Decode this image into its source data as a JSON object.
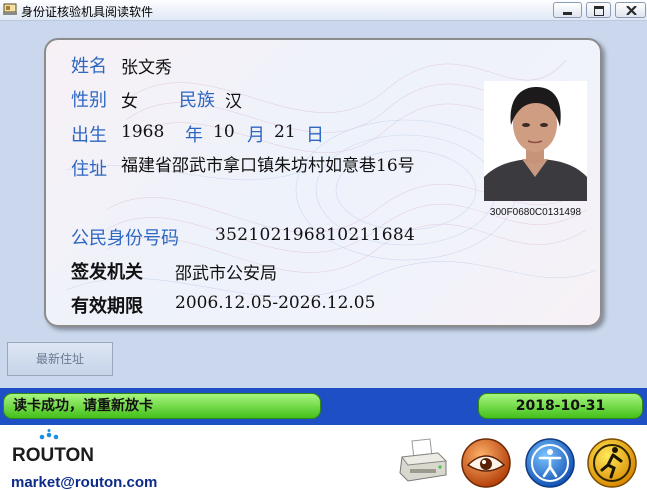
{
  "window": {
    "title": "身份证核验机具阅读软件"
  },
  "card": {
    "name_label": "姓名",
    "name": "张文秀",
    "gender_label": "性别",
    "gender": "女",
    "ethnicity_label": "民族",
    "ethnicity": "汉",
    "birth_label": "出生",
    "birth_year": "1968",
    "year_unit": "年",
    "birth_month": "10",
    "month_unit": "月",
    "birth_day": "21",
    "day_unit": "日",
    "address_label": "住址",
    "address": "福建省邵武市拿口镇朱坊村如意巷16号",
    "id_number_label": "公民身份号码",
    "id_number": "352102196810211684",
    "authority_label": "签发机关",
    "authority": "邵武市公安局",
    "validity_label": "有效期限",
    "validity": "2006.12.05-2026.12.05",
    "photo_id": "300F0680C0131498"
  },
  "buttons": {
    "new_address": "最新住址"
  },
  "status": {
    "message": "读卡成功，请重新放卡",
    "date": "2018-10-31"
  },
  "footer": {
    "logo_text": "ROUTON",
    "email": "market@routon.com"
  },
  "icons": [
    "printer-icon",
    "eye-icon",
    "accessibility-icon",
    "exit-icon"
  ]
}
